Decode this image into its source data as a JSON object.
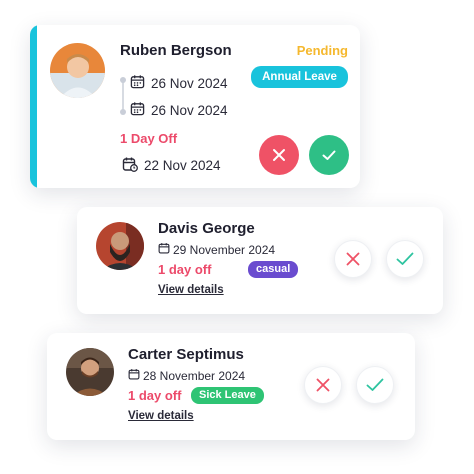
{
  "colors": {
    "accent": "#19c3dc",
    "pending": "#f5b82e",
    "day_off": "#ec4a6a",
    "reject": "#ef5266",
    "approve": "#2ebf86",
    "casual_badge": "#6a4ccf",
    "sick_badge": "#2ec474"
  },
  "requests": [
    {
      "name": "Ruben Bergson",
      "status": "Pending",
      "leave_type": "Annual Leave",
      "start_date": "26 Nov 2024",
      "end_date": "26 Nov 2024",
      "duration": "1 Day Off",
      "requested_date": "22 Nov 2024",
      "reject_icon": "close-icon",
      "approve_icon": "check-icon"
    },
    {
      "name": "Davis George",
      "date": "29 November 2024",
      "duration": "1 day off",
      "leave_type": "casual",
      "details_link": "View details"
    },
    {
      "name": "Carter Septimus",
      "date": "28 November 2024",
      "duration": "1 day off",
      "leave_type": "Sick Leave",
      "details_link": "View details"
    }
  ]
}
